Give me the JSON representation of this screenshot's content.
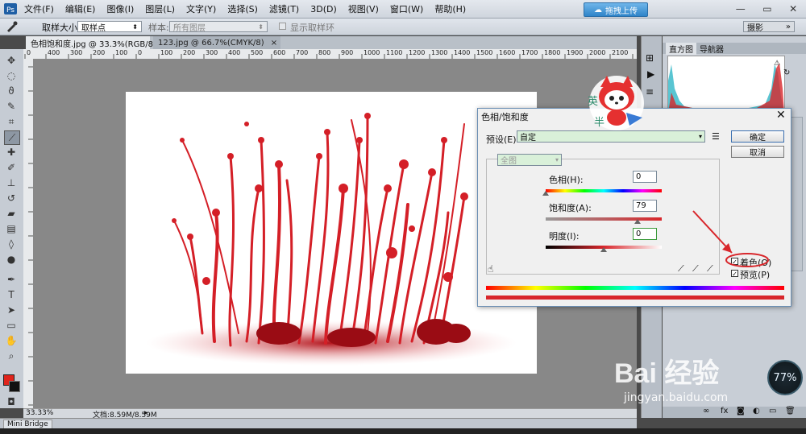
{
  "menubar": {
    "items": [
      "文件(F)",
      "编辑(E)",
      "图像(I)",
      "图层(L)",
      "文字(Y)",
      "选择(S)",
      "滤镜(T)",
      "3D(D)",
      "视图(V)",
      "窗口(W)",
      "帮助(H)"
    ],
    "upload_button": "拖拽上传",
    "workspace": "摄影",
    "window_controls": [
      "—",
      "▭",
      "✕"
    ]
  },
  "options": {
    "sample_size_label": "取样大小:",
    "sample_size_value": "取样点",
    "sample_label": "样本:",
    "sample_value": "所有图层",
    "show_ring_label": "显示取样环"
  },
  "tabs": [
    {
      "label": "色相饱和度.jpg @ 33.3%(RGB/8*)",
      "close": "×"
    },
    {
      "label": "123.jpg @ 66.7%(CMYK/8)",
      "close": "×"
    }
  ],
  "ruler": {
    "ticks": [
      "0",
      "400",
      "300",
      "200",
      "100",
      "0",
      "100",
      "200",
      "300",
      "400",
      "500",
      "600",
      "700",
      "800",
      "900",
      "1000",
      "1100",
      "1200",
      "1300",
      "1400",
      "1500",
      "1600",
      "1700",
      "1800",
      "1900",
      "2000",
      "2100",
      "2200",
      "2300"
    ]
  },
  "status": {
    "zoom": "33.33%",
    "doc_info": "文档:8.59M/8.59M"
  },
  "minibridge": {
    "label": "Mini Bridge",
    "icons": [
      "fx-icon"
    ]
  },
  "panel": {
    "tabs": [
      "直方图",
      "导航器"
    ]
  },
  "dialog": {
    "title": "色相/饱和度",
    "close": "✕",
    "preset_label": "预设(E):",
    "preset_value": "自定",
    "channel_value": "全图",
    "hue_label": "色相(H):",
    "hue_value": "0",
    "saturation_label": "饱和度(A):",
    "saturation_value": "79",
    "lightness_label": "明度(I):",
    "lightness_value": "0",
    "ok_label": "确定",
    "cancel_label": "取消",
    "colorize_label": "着色(O)",
    "colorize_checked": true,
    "preview_label": "预览(P)",
    "preview_checked": true,
    "slider_fractions": {
      "hue": 0.0,
      "saturation": 0.79,
      "lightness": 0.5
    }
  },
  "mascot": {
    "chars": [
      "英",
      "半"
    ]
  },
  "watermark": {
    "brand": "Bai 经验",
    "url": "jingyan.baidu.com"
  },
  "perf_meter": {
    "value": "77%"
  },
  "colors": {
    "foreground": "#e0241c",
    "background": "#111111",
    "accent_red": "#d8262b"
  }
}
